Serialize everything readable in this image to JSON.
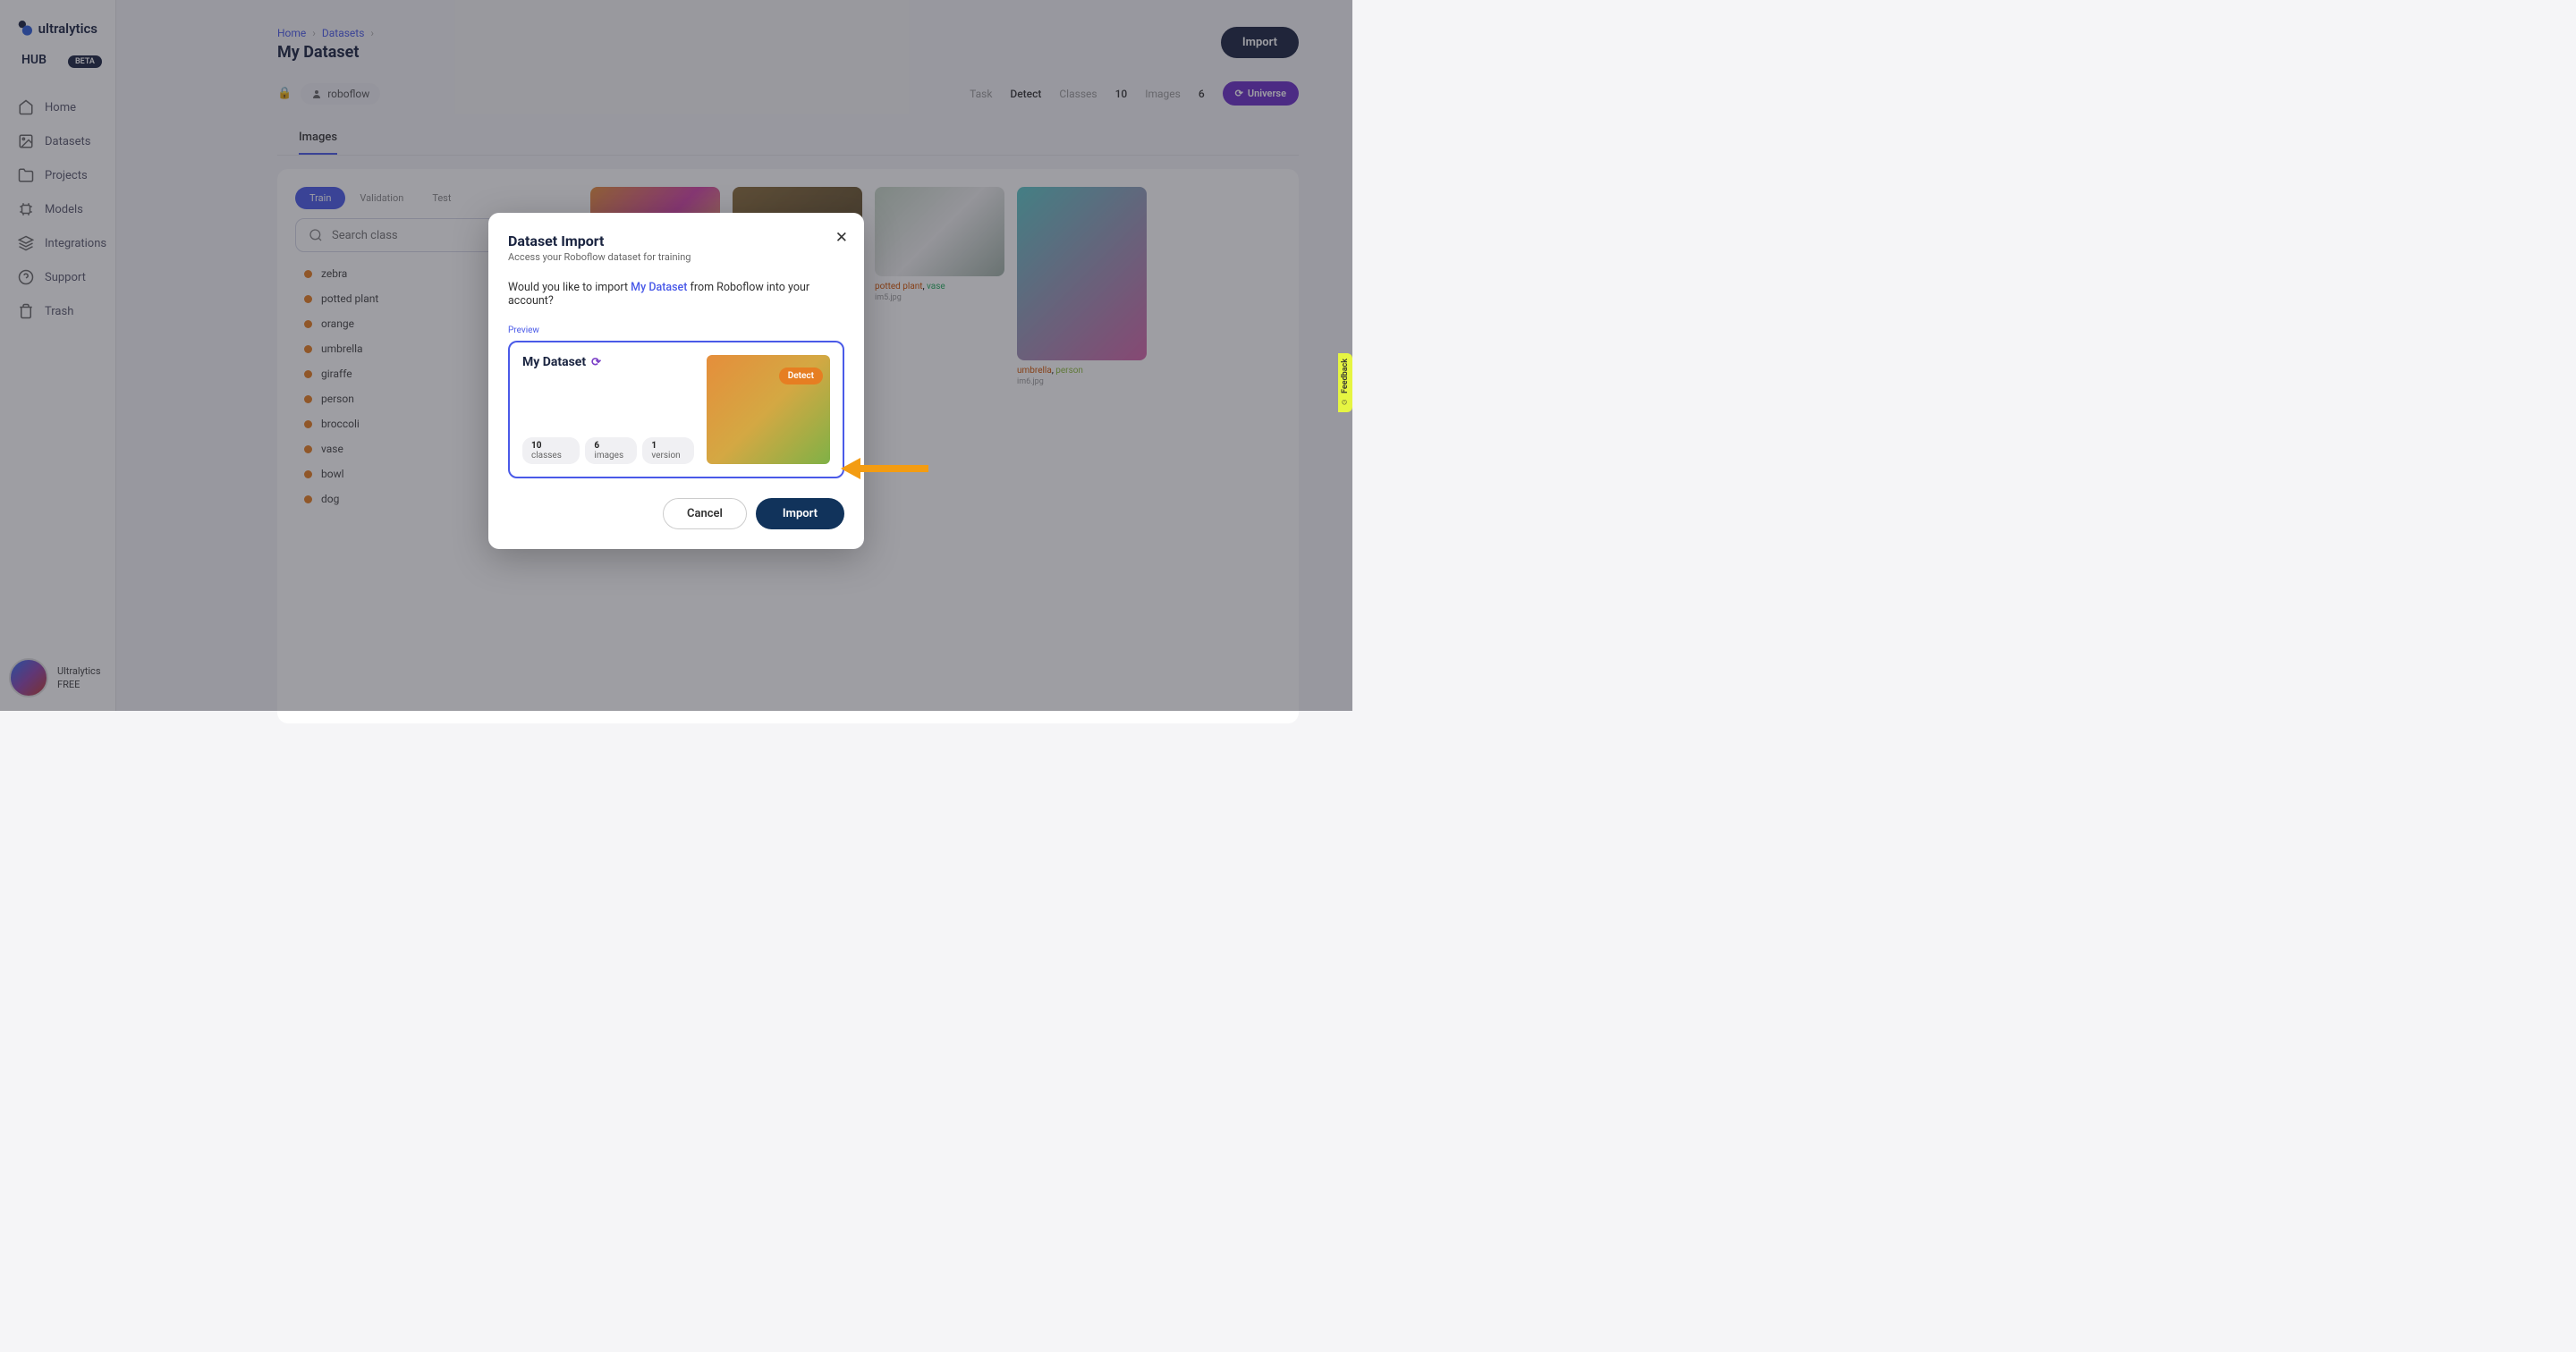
{
  "brand": {
    "name": "ultralytics",
    "hub": "HUB",
    "badge": "BETA"
  },
  "nav": [
    {
      "label": "Home",
      "icon": "home"
    },
    {
      "label": "Datasets",
      "icon": "image"
    },
    {
      "label": "Projects",
      "icon": "folder"
    },
    {
      "label": "Models",
      "icon": "grid"
    },
    {
      "label": "Integrations",
      "icon": "layers"
    },
    {
      "label": "Support",
      "icon": "help"
    },
    {
      "label": "Trash",
      "icon": "trash"
    }
  ],
  "user": {
    "name": "Ultralytics",
    "plan": "FREE"
  },
  "breadcrumb": {
    "home": "Home",
    "datasets": "Datasets"
  },
  "page_title": "My Dataset",
  "import_button": "Import",
  "owner": {
    "name": "roboflow"
  },
  "meta": {
    "task_label": "Task",
    "task_value": "Detect",
    "classes_label": "Classes",
    "classes_value": "10",
    "images_label": "Images",
    "images_value": "6",
    "universe_label": "Universe"
  },
  "main_tab": "Images",
  "splits": {
    "train": "Train",
    "validation": "Validation",
    "test": "Test"
  },
  "search_placeholder": "Search class",
  "classes": [
    "zebra",
    "potted plant",
    "orange",
    "umbrella",
    "giraffe",
    "person",
    "broccoli",
    "vase",
    "bowl",
    "dog"
  ],
  "images": [
    {
      "file": "",
      "labels": []
    },
    {
      "file": "",
      "labels": []
    },
    {
      "file": "im5.jpg",
      "labels": [
        {
          "name": "potted plant",
          "cls": "lbl-potted"
        },
        {
          "name": "vase",
          "cls": "lbl-vase"
        }
      ]
    },
    {
      "file": "im6.jpg",
      "labels": [
        {
          "name": "umbrella",
          "cls": "lbl-umbrella"
        },
        {
          "name": "person",
          "cls": "lbl-person"
        }
      ],
      "tall": true
    }
  ],
  "modal": {
    "title": "Dataset Import",
    "subtitle": "Access your Roboflow dataset for training",
    "body_prefix": "Would you like to import ",
    "body_ds": "My Dataset",
    "body_suffix": " from Roboflow into your account?",
    "preview_label": "Preview",
    "preview_name": "My Dataset",
    "stats": {
      "classes_n": "10",
      "classes_l": "classes",
      "images_n": "6",
      "images_l": "images",
      "versions_n": "1",
      "versions_l": "version"
    },
    "detect": "Detect",
    "cancel": "Cancel",
    "import": "Import"
  },
  "feedback": "Feedback"
}
